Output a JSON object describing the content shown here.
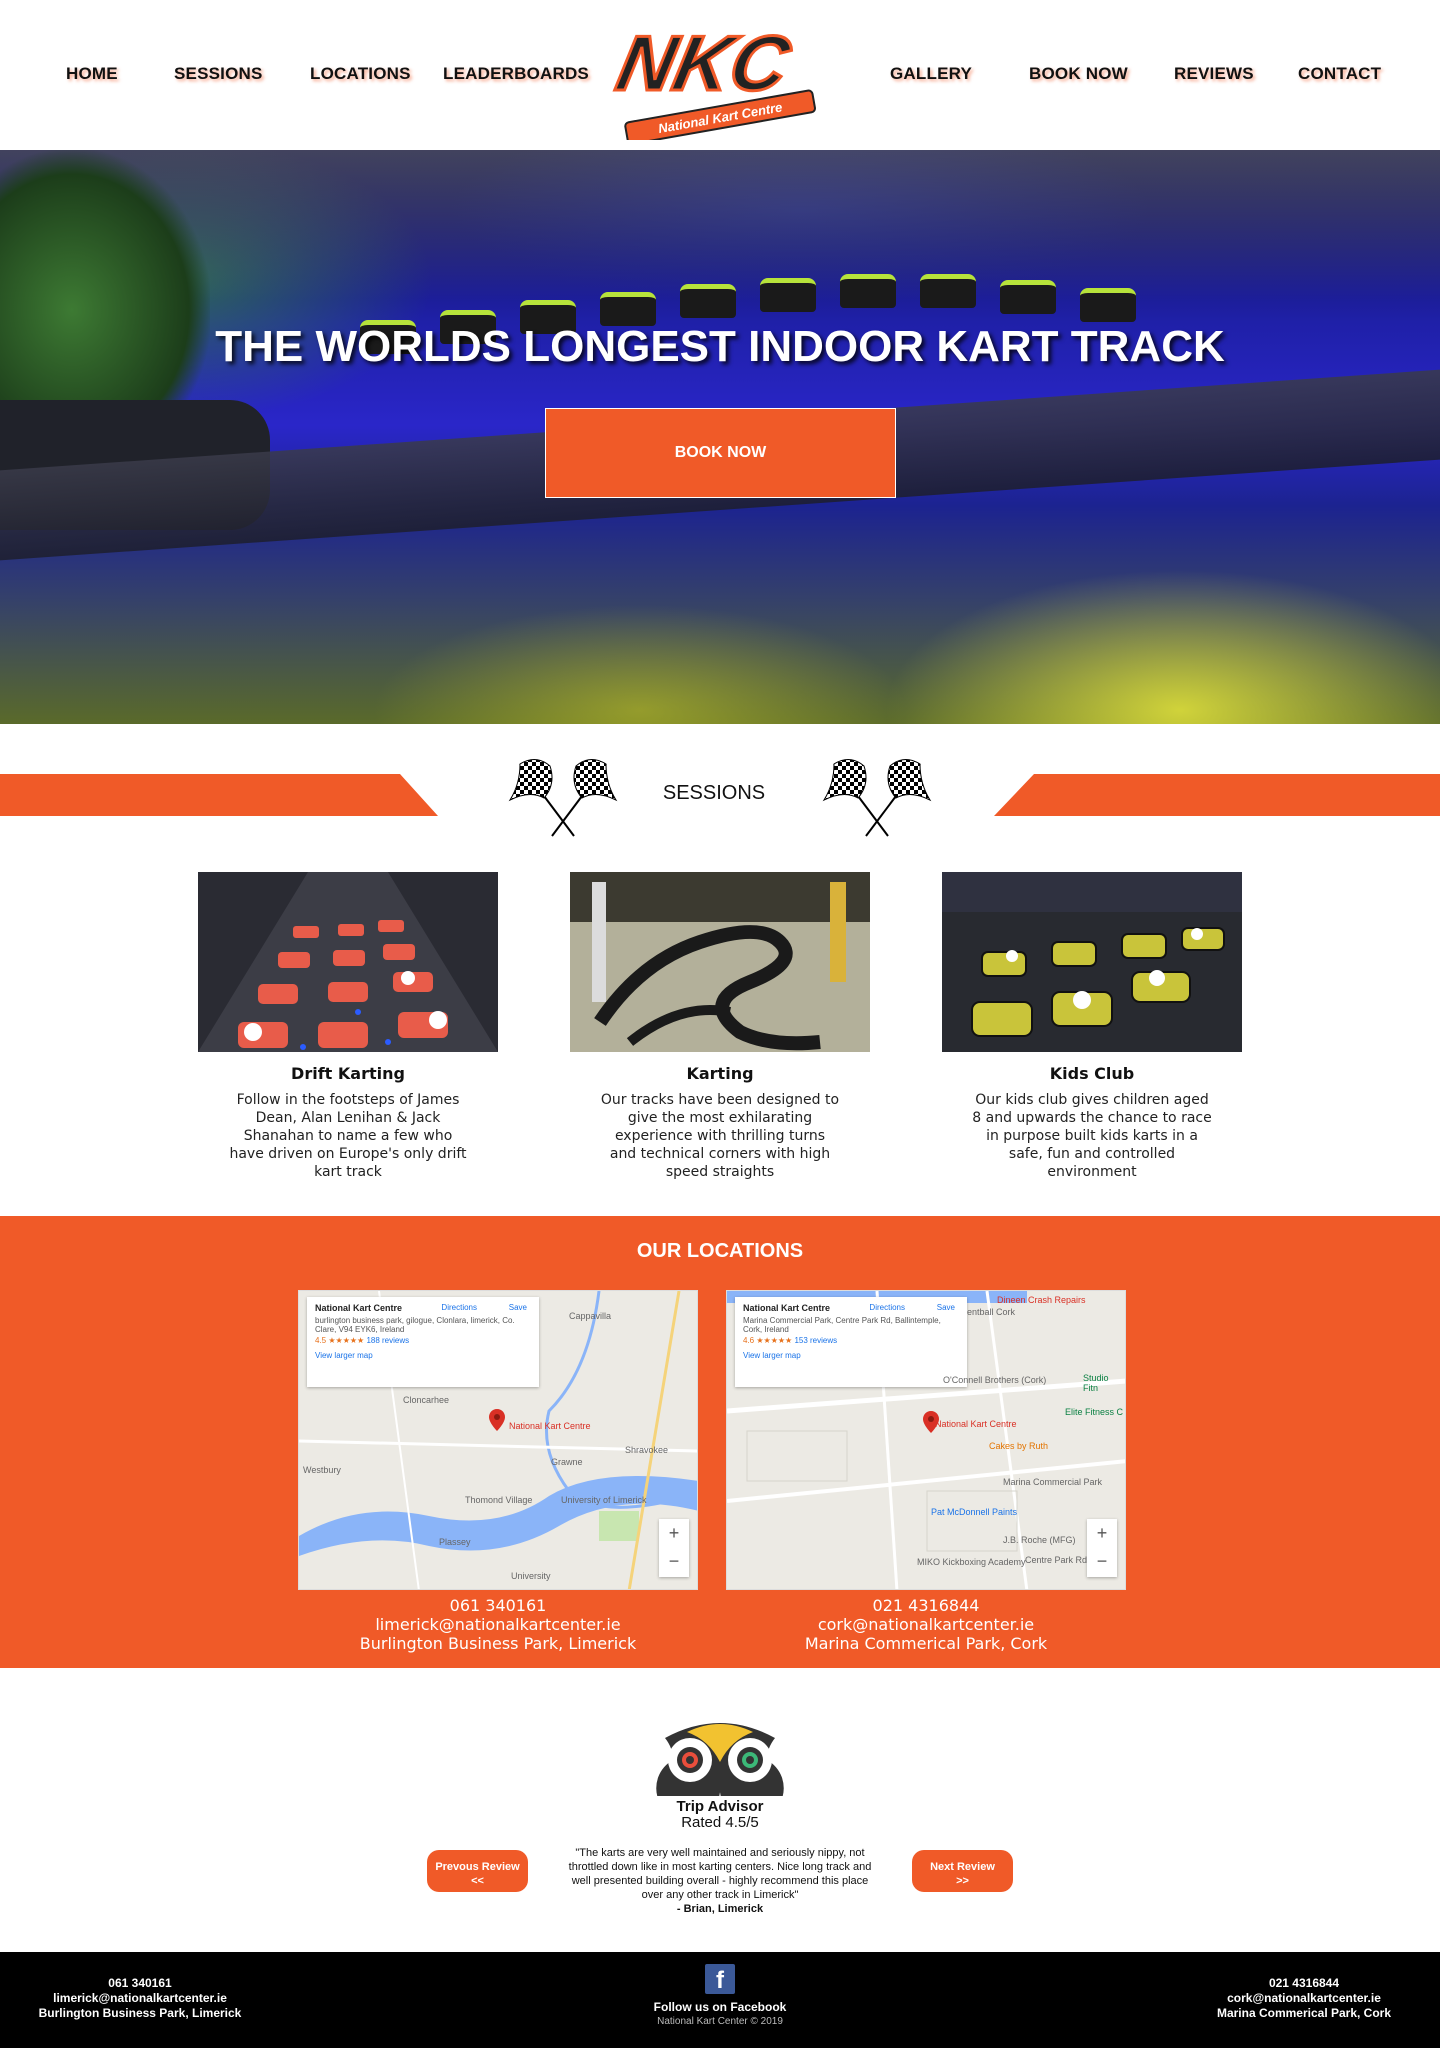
{
  "nav": {
    "items": [
      "HOME",
      "SESSIONS",
      "LOCATIONS",
      "LEADERBOARDS",
      "GALLERY",
      "BOOK NOW",
      "REVIEWS",
      "CONTACT"
    ],
    "logo_text": "NKC",
    "logo_subtitle": "National Kart Centre"
  },
  "hero": {
    "title": "THE WORLDS LONGEST INDOOR KART TRACK",
    "button_label": "BOOK NOW"
  },
  "sessions": {
    "title": "SESSIONS",
    "cards": [
      {
        "name": "Drift Karting",
        "description": "Follow in the footsteps of James Dean, Alan Lenihan & Jack Shanahan to name a few who have driven on Europe's only drift kart track"
      },
      {
        "name": "Karting",
        "description": "Our tracks have been designed to give the most exhilarating experience with thrilling turns and technical corners with high speed straights"
      },
      {
        "name": "Kids Club",
        "description": "Our kids club gives children aged 8 and upwards the chance to race in purpose built kids karts in a safe, fun and controlled environment"
      }
    ]
  },
  "locations": {
    "title": "OUR LOCATIONS",
    "items": [
      {
        "map_name": "National Kart Centre",
        "map_address": "burlington business park, gilogue, Clonlara, limerick, Co. Clare, V94 EYK6, Ireland",
        "map_rating": "4.5 ★★★★★",
        "map_reviews": "188 reviews",
        "map_link": "View larger map",
        "map_directions": "Directions",
        "map_save": "Save",
        "map_places": [
          "Cappavilla",
          "Cloncarhee",
          "National Kart Centre",
          "Shravokee",
          "Westbury",
          "Grawne",
          "Thomond Village",
          "University of Limerick",
          "Plassey",
          "University"
        ],
        "phone": "061 340161",
        "email": "limerick@nationalkartcenter.ie",
        "address": "Burlington Business Park, Limerick"
      },
      {
        "map_name": "National Kart Centre",
        "map_address": "Marina Commercial Park, Centre Park Rd, Ballintemple, Cork, Ireland",
        "map_rating": "4.6 ★★★★★",
        "map_reviews": "153 reviews",
        "map_link": "View larger map",
        "map_directions": "Directions",
        "map_save": "Save",
        "map_places": [
          "Dineen Crash Repairs",
          "entball Cork",
          "O'Connell Brothers (Cork)",
          "Studio Fitn",
          "Elite Fitness C",
          "National Kart Centre",
          "Cakes by Ruth",
          "Marina Commercial Park",
          "Pat McDonnell Paints",
          "J.B. Roche (MFG)",
          "MIKO Kickboxing Academy",
          "Centre Park Rd"
        ],
        "phone": "021 4316844",
        "email": "cork@nationalkartcenter.ie",
        "address": "Marina Commerical Park, Cork"
      }
    ]
  },
  "reviews": {
    "source_name": "Trip Advisor",
    "rating": "Rated 4.5/5",
    "prev_label": "Prevous Review",
    "prev_arrow": "<<",
    "next_label": "Next Review",
    "next_arrow": ">>",
    "quote": "\"The karts are very well maintained and seriously nippy, not throttled down like in most karting centers. Nice long track and well presented building overall - highly recommend this place over any other track in Limerick\"",
    "author": "- Brian, Limerick"
  },
  "footer": {
    "left": {
      "phone": "061 340161",
      "email": "limerick@nationalkartcenter.ie",
      "address": "Burlington Business Park, Limerick"
    },
    "center": {
      "follow": "Follow us on Facebook",
      "copyright": "National Kart Center © 2019",
      "fb_glyph": "f"
    },
    "right": {
      "phone": "021 4316844",
      "email": "cork@nationalkartcenter.ie",
      "address": "Marina Commerical Park, Cork"
    }
  },
  "colors": {
    "accent": "#f05a28",
    "dark": "#000000",
    "facebook": "#3b5998"
  }
}
